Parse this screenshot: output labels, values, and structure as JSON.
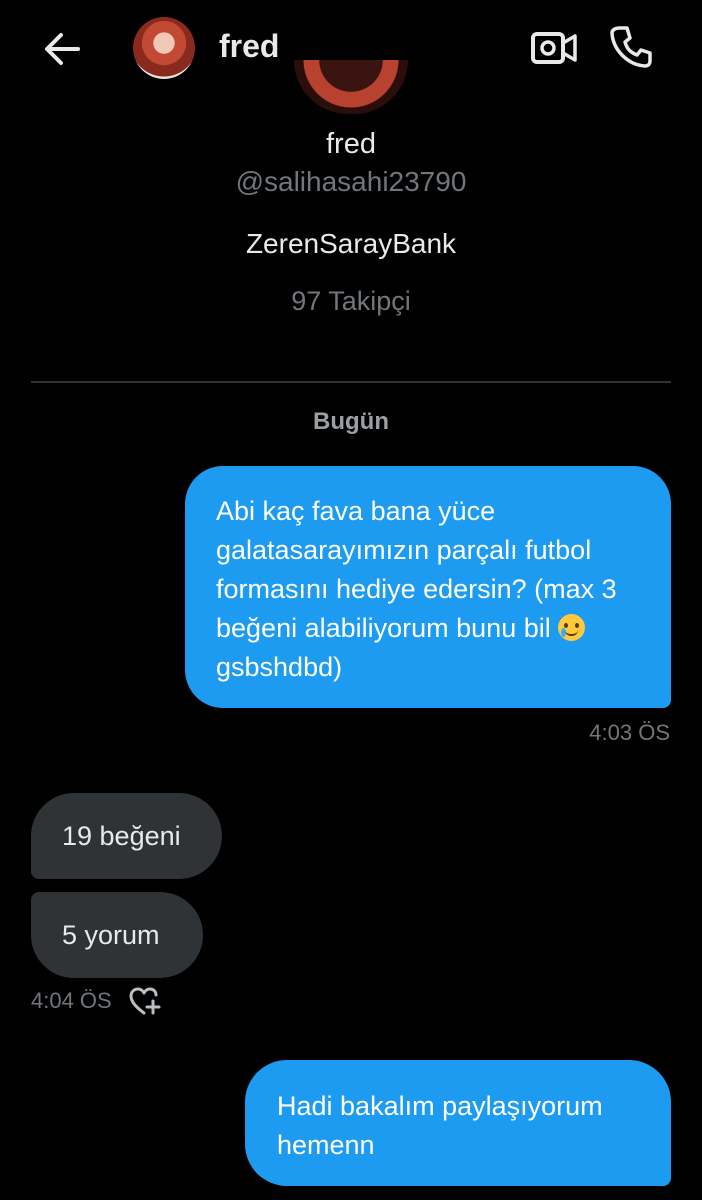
{
  "header": {
    "title": "fred",
    "back_icon": "arrow-left-icon",
    "video_icon": "video-camera-icon",
    "call_icon": "phone-icon"
  },
  "profile": {
    "name": "fred",
    "handle": "@salihasahi23790",
    "bio": "ZerenSarayBank",
    "followers": "97 Takipçi"
  },
  "chat": {
    "day_label": "Bugün",
    "messages": [
      {
        "direction": "out",
        "text_before_emoji": "Abi kaç fava bana yüce galatasarayımızın parçalı futbol formasını hediye edersin? (max 3 beğeni alabiliyorum bunu bil ",
        "emoji": "smiling-face-with-tear",
        "text_after_emoji": " gsbshdbd)",
        "time": "4:03 ÖS"
      },
      {
        "direction": "in",
        "text": "19 beğeni"
      },
      {
        "direction": "in",
        "text": "5 yorum",
        "time": "4:04 ÖS",
        "reaction_icon": "heart-plus-icon"
      },
      {
        "direction": "out",
        "text": "Hadi bakalım paylaşıyorum hemenn"
      }
    ]
  },
  "colors": {
    "background": "#000000",
    "outgoing_bubble": "#1d9bf0",
    "incoming_bubble": "#2f3336",
    "muted_text": "#71767b"
  }
}
